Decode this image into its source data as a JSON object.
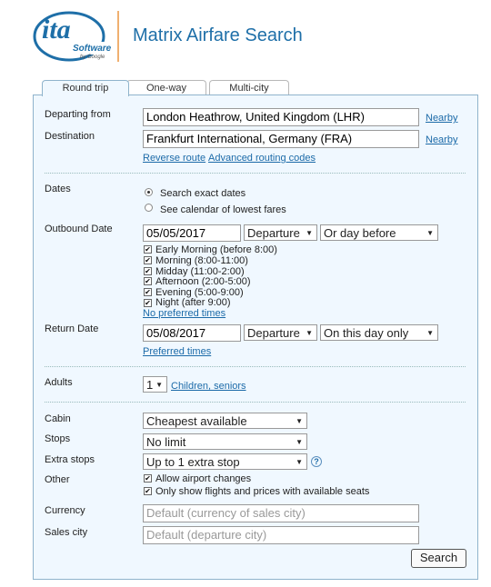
{
  "header": {
    "logo_main": "ita",
    "logo_sub": "Software",
    "logo_by": "by Google",
    "title": "Matrix Airfare Search"
  },
  "tabs": [
    {
      "label": "Round trip",
      "active": true
    },
    {
      "label": "One-way",
      "active": false
    },
    {
      "label": "Multi-city",
      "active": false
    }
  ],
  "route": {
    "departing_label": "Departing from",
    "departing_value": "London Heathrow, United Kingdom (LHR)",
    "destination_label": "Destination",
    "destination_value": "Frankfurt International, Germany (FRA)",
    "nearby_link": "Nearby",
    "reverse_link": "Reverse route",
    "advanced_link": "Advanced routing codes"
  },
  "dates": {
    "label": "Dates",
    "option_exact": "Search exact dates",
    "option_calendar": "See calendar of lowest fares",
    "selected": "exact"
  },
  "outbound": {
    "label": "Outbound Date",
    "date": "05/05/2017",
    "type": "Departure",
    "flex": "Or day before",
    "times": [
      {
        "label": "Early Morning (before 8:00)",
        "checked": true
      },
      {
        "label": "Morning (8:00-11:00)",
        "checked": true
      },
      {
        "label": "Midday (11:00-2:00)",
        "checked": true
      },
      {
        "label": "Afternoon (2:00-5:00)",
        "checked": true
      },
      {
        "label": "Evening (5:00-9:00)",
        "checked": true
      },
      {
        "label": "Night (after 9:00)",
        "checked": true
      }
    ],
    "no_pref_link": "No preferred times"
  },
  "return": {
    "label": "Return Date",
    "date": "05/08/2017",
    "type": "Departure",
    "flex": "On this day only",
    "pref_link": "Preferred times"
  },
  "passengers": {
    "adults_label": "Adults",
    "adults_value": "1",
    "children_link": "Children, seniors"
  },
  "options": {
    "cabin_label": "Cabin",
    "cabin_value": "Cheapest available",
    "stops_label": "Stops",
    "stops_value": "No limit",
    "extra_label": "Extra stops",
    "extra_value": "Up to 1 extra stop",
    "help": "?",
    "other_label": "Other",
    "allow_airport": "Allow airport changes",
    "only_available": "Only show flights and prices with available seats",
    "currency_label": "Currency",
    "currency_placeholder": "Default (currency of sales city)",
    "sales_label": "Sales city",
    "sales_placeholder": "Default (departure city)"
  },
  "actions": {
    "search_label": "Search"
  },
  "colors": {
    "title": "#1e6fa8",
    "panel_bg": "#f0f8ff",
    "link": "#1b6aa8"
  }
}
